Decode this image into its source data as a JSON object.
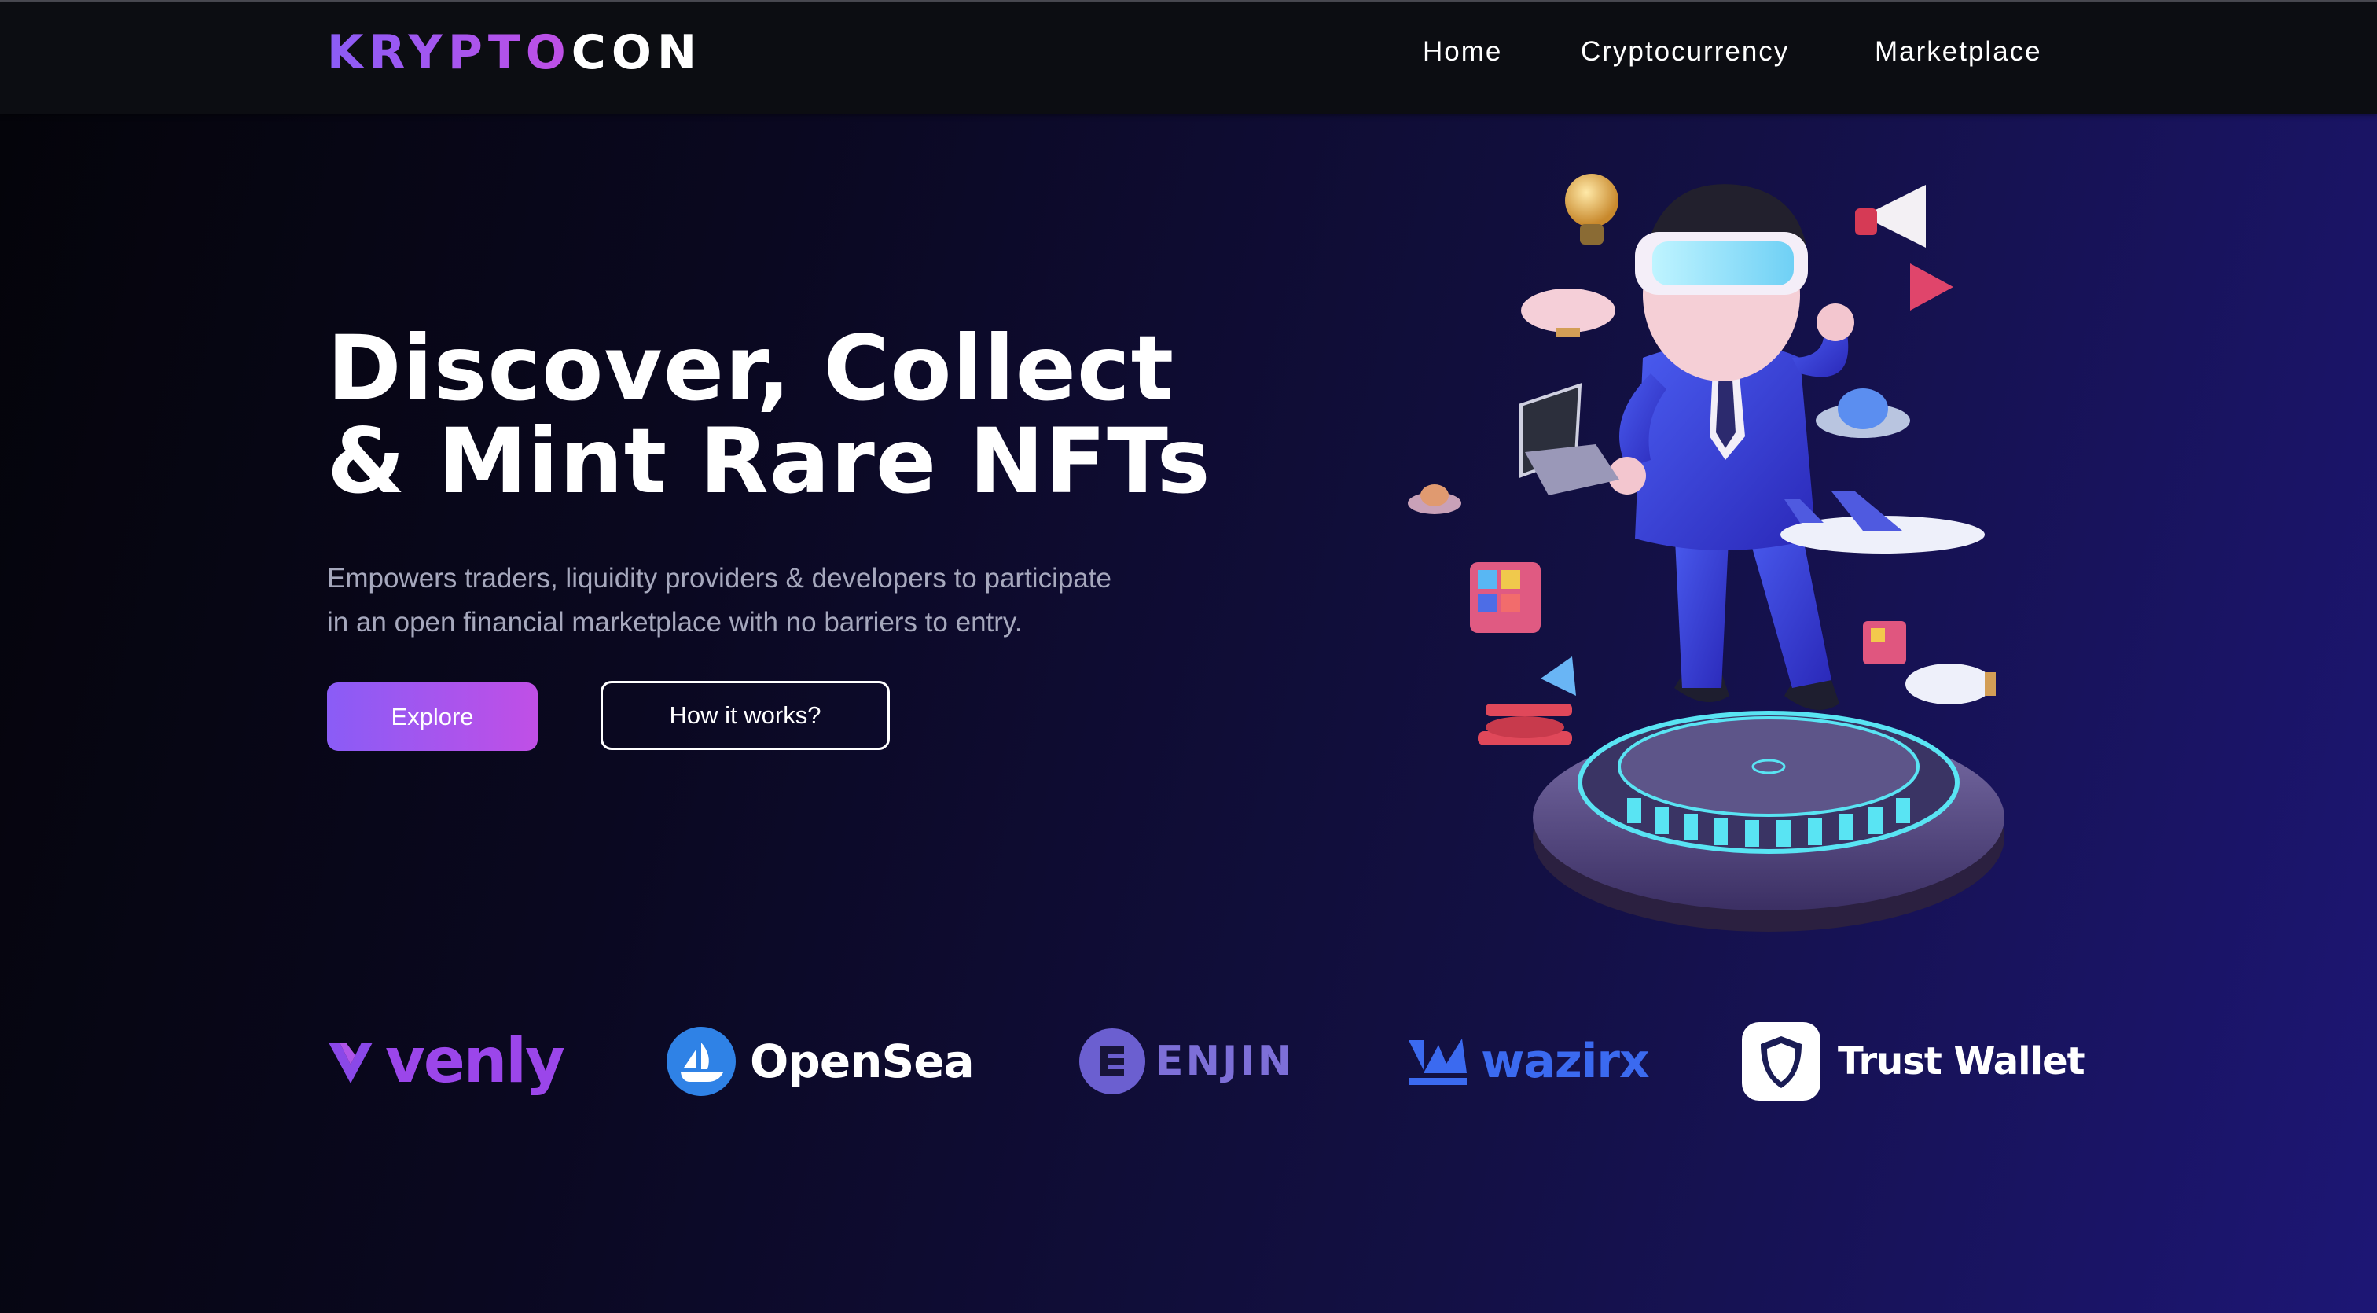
{
  "brand": {
    "logo_part1": "KRYPTO",
    "logo_part2": "CON"
  },
  "nav": {
    "items": [
      {
        "label": "Home"
      },
      {
        "label": "Cryptocurrency"
      },
      {
        "label": "Marketplace"
      }
    ]
  },
  "hero": {
    "title_line1": "Discover, Collect",
    "title_line2": "& Mint Rare NFTs",
    "description_line1": "Empowers traders, liquidity providers & developers to participate",
    "description_line2": "in an open financial marketplace with no barriers to entry.",
    "primary_button": "Explore",
    "secondary_button": "How it works?"
  },
  "partners": [
    {
      "name": "venly",
      "icon": "venly-v-icon"
    },
    {
      "name": "OpenSea",
      "icon": "opensea-boat-icon"
    },
    {
      "name": "ENJIN",
      "icon": "enjin-e-icon"
    },
    {
      "name": "wazirx",
      "icon": "wazirx-icon"
    },
    {
      "name": "Trust Wallet",
      "icon": "shield-icon"
    }
  ],
  "colors": {
    "accent_start": "#8a5cf6",
    "accent_end": "#c04fe6",
    "background_dark": "#040409",
    "background_blue": "#1d1675",
    "navbar": "#0c0d12",
    "subtext": "#a6a8bd"
  },
  "illustration": "astronaut-with-vr-headset-on-platform"
}
